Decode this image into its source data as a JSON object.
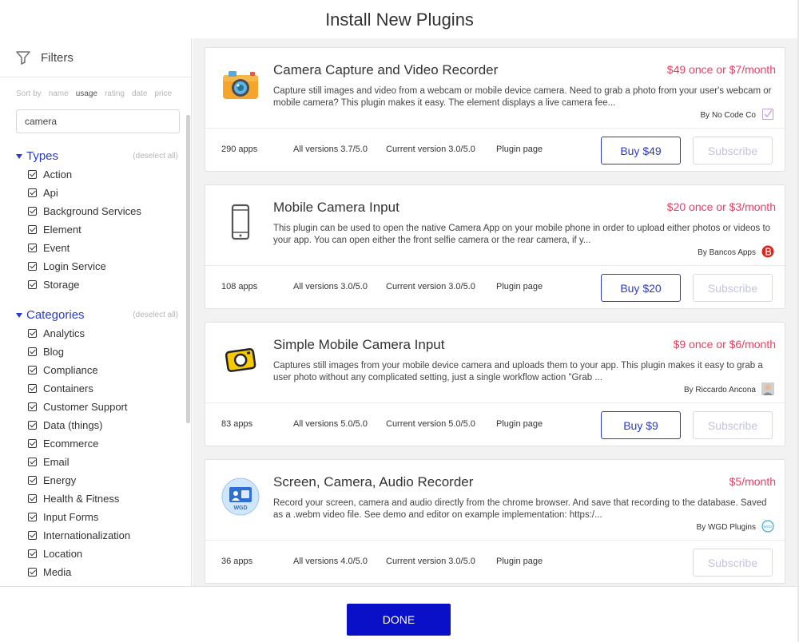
{
  "title": "Install New Plugins",
  "filters": {
    "label": "Filters",
    "sort_label": "Sort by",
    "sort_options": [
      "name",
      "usage",
      "rating",
      "date",
      "price"
    ],
    "sort_active": "usage",
    "search_value": "camera",
    "types_title": "Types",
    "deselect_label": "(deselect all)",
    "types": [
      "Action",
      "Api",
      "Background Services",
      "Element",
      "Event",
      "Login Service",
      "Storage"
    ],
    "categories_title": "Categories",
    "categories": [
      "Analytics",
      "Blog",
      "Compliance",
      "Containers",
      "Customer Support",
      "Data (things)",
      "Ecommerce",
      "Email",
      "Energy",
      "Health & Fitness",
      "Input Forms",
      "Internationalization",
      "Location",
      "Media"
    ]
  },
  "plugins": [
    {
      "name": "Camera Capture and Video Recorder",
      "price": "$49 once or $7/month",
      "description": "Capture still images and video from a webcam or mobile device camera. Need to grab a photo from your user's webcam or mobile camera? This plugin makes it easy. The element displays a live camera fee...",
      "author": "By No Code Co",
      "apps": "290 apps",
      "all_versions": "All versions 3.7/5.0",
      "current_version": "Current version 3.0/5.0",
      "page_link": "Plugin page",
      "buy_label": "Buy $49",
      "subscribe_label": "Subscribe",
      "logo_icon": "camera-icon",
      "avatar_icon": "checkbox-avatar-icon"
    },
    {
      "name": "Mobile Camera Input",
      "price": "$20 once or $3/month",
      "description": "This plugin can be used to open the native Camera App on your mobile phone in order to upload either photos or videos to your app. You can open either the front selfie camera or the rear camera, if y...",
      "author": "By Bancos Apps",
      "apps": "108 apps",
      "all_versions": "All versions 3.0/5.0",
      "current_version": "Current version 3.0/5.0",
      "page_link": "Plugin page",
      "buy_label": "Buy $20",
      "subscribe_label": "Subscribe",
      "logo_icon": "mobile-phone-icon",
      "avatar_icon": "bancos-avatar-icon"
    },
    {
      "name": "Simple Mobile Camera Input",
      "price": "$9 once or $6/month",
      "description": "Captures still images from your mobile device camera and uploads them to your app. This plugin makes it easy to grab a user photo without any complicated setting, just a single workflow action \"Grab ...",
      "author": "By Riccardo Ancona",
      "apps": "83 apps",
      "all_versions": "All versions 5.0/5.0",
      "current_version": "Current version 5.0/5.0",
      "page_link": "Plugin page",
      "buy_label": "Buy $9",
      "subscribe_label": "Subscribe",
      "logo_icon": "yellow-camera-icon",
      "avatar_icon": "person-avatar-icon"
    },
    {
      "name": "Screen, Camera, Audio Recorder",
      "price": "$5/month",
      "description": "Record your screen, camera and audio directly from the chrome browser. And save that recording to the database. Saved as a .webm video file. See demo and editor on example implementation: https:/...",
      "author": "By WGD Plugins",
      "apps": "36 apps",
      "all_versions": "All versions 4.0/5.0",
      "current_version": "Current version 3.0/5.0",
      "page_link": "Plugin page",
      "buy_label": "",
      "subscribe_label": "Subscribe",
      "logo_icon": "screen-recorder-icon",
      "logo_text": "WGD",
      "avatar_icon": "wgd-avatar-icon",
      "avatar_text": "WGD"
    }
  ],
  "footer": {
    "done_label": "DONE"
  }
}
